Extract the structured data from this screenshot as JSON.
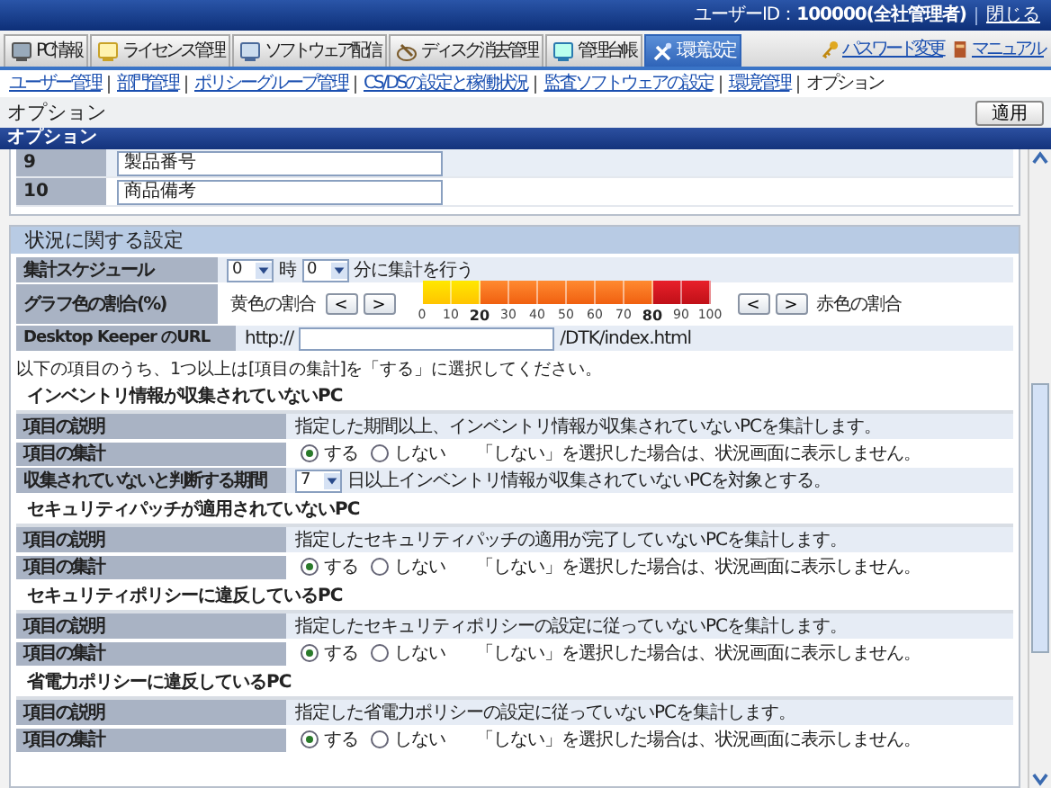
{
  "top_bar": {
    "user": "ユーザーID：**100000(全社管理者)**",
    "close_link": "閉じる"
  },
  "tabs": [
    {
      "label": "PC情報",
      "selected": false
    },
    {
      "label": "ライセンス管理",
      "selected": false
    },
    {
      "label": "ソフトウェア配信",
      "selected": false
    },
    {
      "label": "ディスク消去管理",
      "selected": false
    },
    {
      "label": "管理台帳",
      "selected": false
    },
    {
      "label": "環境設定",
      "selected": true
    }
  ],
  "header_links": [
    {
      "label": "パスワード変更"
    },
    {
      "label": "マニュアル"
    }
  ],
  "sub_nav": [
    {
      "label": "ユーザー管理",
      "selected": false
    },
    {
      "label": "部門管理",
      "selected": false
    },
    {
      "label": "ポリシーグループ管理",
      "selected": false
    },
    {
      "label": "CS/DSの設定と稼働状況",
      "selected": false
    },
    {
      "label": "監査ソフトウェアの設定",
      "selected": false
    },
    {
      "label": "環境管理",
      "selected": false
    },
    {
      "label": "オプション",
      "selected": true
    }
  ],
  "page": {
    "title": "オプション",
    "apply_button": "適用"
  },
  "panel_title": "オプション",
  "item_rows": [
    {
      "number": "9",
      "value": "製品番号"
    },
    {
      "number": "10",
      "value": "商品備考"
    }
  ],
  "status_settings": {
    "title": "状況に関する設定",
    "schedule": {
      "label": "集計スケジュール",
      "hour": "0",
      "hour_unit": "時",
      "minute": "0",
      "suffix": "分に集計を行う"
    },
    "graph": {
      "label": "グラフ色の割合(%)",
      "yellow": {
        "label": "黄色の割合",
        "buttons": [
          "<",
          ">"
        ]
      },
      "red": {
        "label": "赤色の割合",
        "buttons": [
          "<",
          ">"
        ]
      },
      "thresholds": [
        {
          "level": 0.2
        },
        {
          "level": 0.8
        }
      ],
      "ticks": [
        {
          "label": "0",
          "selected": false
        },
        {
          "label": "10",
          "selected": false
        },
        {
          "label": "20",
          "selected": true
        },
        {
          "label": "30",
          "selected": false
        },
        {
          "label": "40",
          "selected": false
        },
        {
          "label": "50",
          "selected": false
        },
        {
          "label": "60",
          "selected": false
        },
        {
          "label": "70",
          "selected": false
        },
        {
          "label": "80",
          "selected": true
        },
        {
          "label": "90",
          "selected": false
        },
        {
          "label": "100",
          "selected": false
        }
      ]
    },
    "url": {
      "label": "Desktop Keeper のURL",
      "prefix": "http://",
      "suffix": "/DTK/index.html"
    }
  },
  "note": "以下の項目のうち、1つ以上は[項目の集計]を「する」に選択してください。",
  "groups": [
    {
      "title": "インベントリ情報が収集されていないPC",
      "rows": [
        {
          "kind": "text",
          "label": "項目の説明",
          "text": "指定した期間以上、インベントリ情報が収集されていないPCを集計します。"
        },
        {
          "kind": "radio",
          "label": "項目の集計",
          "options": [
            {
              "label": "する",
              "selected": true
            },
            {
              "label": "しない",
              "selected": false
            }
          ],
          "hint": "「しない」を選択した場合は、状況画面に表示しません。"
        },
        {
          "kind": "period",
          "label": "収集されていないと判断する期間",
          "value": "7",
          "suffix": "日以上インベントリ情報が収集されていないPCを対象とする。"
        }
      ]
    },
    {
      "title": "セキュリティパッチが適用されていないPC",
      "rows": [
        {
          "kind": "text",
          "label": "項目の説明",
          "text": "指定したセキュリティパッチの適用が完了していないPCを集計します。"
        },
        {
          "kind": "radio",
          "label": "項目の集計",
          "options": [
            {
              "label": "する",
              "selected": true
            },
            {
              "label": "しない",
              "selected": false
            }
          ],
          "hint": "「しない」を選択した場合は、状況画面に表示しません。"
        }
      ]
    },
    {
      "title": "セキュリティポリシーに違反しているPC",
      "rows": [
        {
          "kind": "text",
          "label": "項目の説明",
          "text": "指定したセキュリティポリシーの設定に従っていないPCを集計します。"
        },
        {
          "kind": "radio",
          "label": "項目の集計",
          "options": [
            {
              "label": "する",
              "selected": true
            },
            {
              "label": "しない",
              "selected": false
            }
          ],
          "hint": "「しない」を選択した場合は、状況画面に表示しません。"
        }
      ]
    },
    {
      "title": "省電力ポリシーに違反しているPC",
      "rows": [
        {
          "kind": "text",
          "label": "項目の説明",
          "text": "指定した省電力ポリシーの設定に従っていないPCを集計します。"
        },
        {
          "kind": "radio",
          "label": "項目の集計",
          "options": [
            {
              "label": "する",
              "selected": true
            },
            {
              "label": "しない",
              "selected": false
            }
          ],
          "hint": "「しない」を選択した場合は、状況画面に表示しません。"
        }
      ]
    }
  ]
}
